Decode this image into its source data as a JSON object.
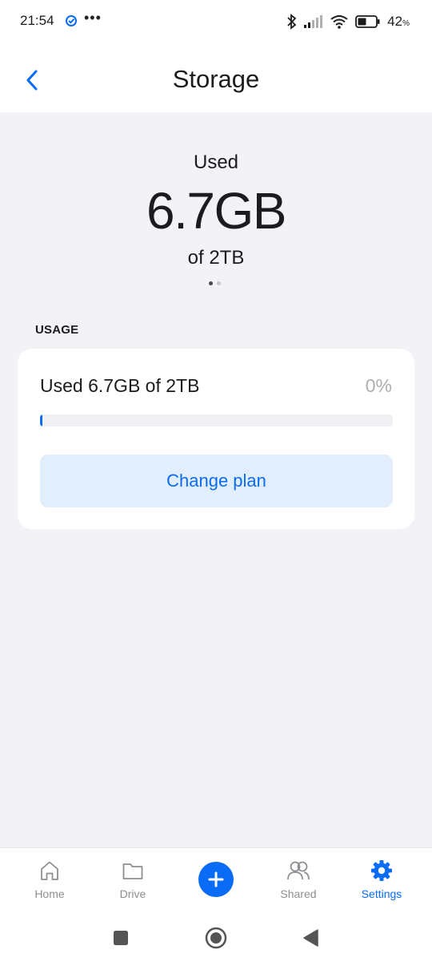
{
  "status_bar": {
    "time": "21:54",
    "dots": "•••",
    "battery_level": "42",
    "battery_unit": "%",
    "icons": [
      "check-badge-icon",
      "bluetooth-icon",
      "signal-icon",
      "wifi-icon",
      "battery-icon"
    ]
  },
  "header": {
    "title": "Storage",
    "back_icon": "chevron-left-icon"
  },
  "summary": {
    "used_label": "Used",
    "used_value": "6.7GB",
    "total_label": "of 2TB",
    "pager_count": 2,
    "pager_active": 0
  },
  "usage": {
    "section_label": "USAGE",
    "text": "Used 6.7GB of 2TB",
    "percent_label": "0%",
    "progress_fraction": 0.0034,
    "button_label": "Change plan"
  },
  "tab_bar": {
    "tabs": [
      {
        "label": "Home",
        "icon": "home-icon",
        "active": false
      },
      {
        "label": "Drive",
        "icon": "folder-icon",
        "active": false
      },
      {
        "label": "Shared",
        "icon": "users-icon",
        "active": false
      },
      {
        "label": "Settings",
        "icon": "gear-icon",
        "active": true
      }
    ],
    "fab_icon": "plus-icon"
  },
  "system_nav": {
    "icons": [
      "recents-square-icon",
      "home-circle-icon",
      "back-triangle-icon"
    ]
  },
  "colors": {
    "accent": "#0a6cf5",
    "background": "#f2f2f7",
    "card": "#ffffff",
    "button_bg": "#e3eefc",
    "muted": "#8e8e93"
  }
}
